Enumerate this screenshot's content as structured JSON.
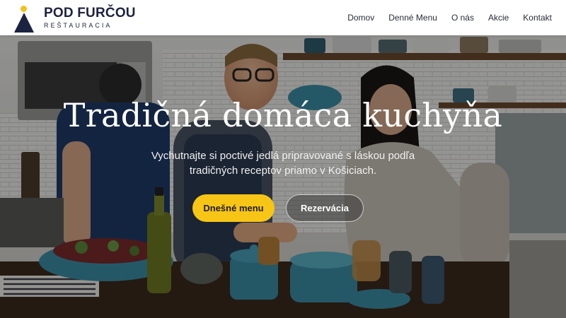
{
  "brand": {
    "name": "POD FURČOU",
    "subtitle": "REŠTAURACIA"
  },
  "nav": {
    "items": [
      {
        "label": "Domov"
      },
      {
        "label": "Denné Menu"
      },
      {
        "label": "O nás"
      },
      {
        "label": "Akcie"
      },
      {
        "label": "Kontakt"
      }
    ]
  },
  "hero": {
    "title": "Tradičná domáca kuchyňa",
    "subtitle": "Vychutnajte si poctivé jedlá pripravované s láskou podľa tradičných receptov priamo v Košiciach.",
    "primary_button": "Dnešné menu",
    "secondary_button": "Rezervácia",
    "background_image": "kitchen-photo"
  },
  "colors": {
    "accent": "#f7c515",
    "brand_navy": "#1c2340",
    "logo_sun": "#f2c21b"
  }
}
